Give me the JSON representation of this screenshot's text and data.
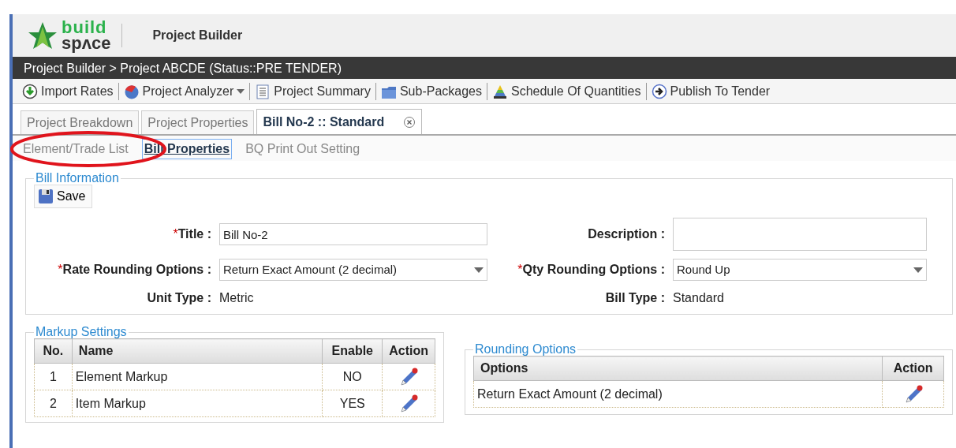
{
  "app": {
    "logo_top": "build",
    "logo_bottom": "spʌce",
    "title": "Project Builder"
  },
  "breadcrumb": "Project Builder > Project ABCDE (Status::PRE TENDER)",
  "toolbar": [
    {
      "label": "Import Rates",
      "kind": "import",
      "dropdown": false
    },
    {
      "label": "Project Analyzer",
      "kind": "chart",
      "dropdown": true
    },
    {
      "label": "Project Summary",
      "kind": "document",
      "dropdown": false
    },
    {
      "label": "Sub-Packages",
      "kind": "folder",
      "dropdown": false
    },
    {
      "label": "Schedule Of Quantities",
      "kind": "pyramid",
      "dropdown": false
    },
    {
      "label": "Publish To Tender",
      "kind": "publish",
      "dropdown": false
    }
  ],
  "tabs": [
    {
      "label": "Project Breakdown",
      "selected": false,
      "closable": false
    },
    {
      "label": "Project Properties",
      "selected": false,
      "closable": false
    },
    {
      "label": "Bill No-2 :: Standard",
      "selected": true,
      "closable": true
    }
  ],
  "subtabs": [
    {
      "label": "Element/Trade List",
      "selected": false,
      "circled": true
    },
    {
      "label": "Bill Properties",
      "selected": true,
      "circled": false
    },
    {
      "label": "BQ Print Out Setting",
      "selected": false,
      "circled": false
    }
  ],
  "bill_information": {
    "legend": "Bill Information",
    "save_label": "Save",
    "required_marker": "*",
    "fields": [
      {
        "label": "Title :",
        "required": true,
        "kind": "text",
        "value": "Bill No-2"
      },
      {
        "label": "Description :",
        "required": false,
        "kind": "textarea"
      },
      {
        "label": "Rate Rounding Options :",
        "required": true,
        "kind": "select",
        "value": "Return Exact Amount (2 decimal)"
      },
      {
        "label": "Qty Rounding Options :",
        "required": true,
        "kind": "select",
        "value": "Round Up"
      },
      {
        "label": "Unit Type :",
        "required": false,
        "kind": "static",
        "value": "Metric"
      },
      {
        "label": "Bill Type :",
        "required": false,
        "kind": "static",
        "value": "Standard"
      }
    ]
  },
  "markup_settings": {
    "legend": "Markup Settings",
    "columns": [
      "No.",
      "Name",
      "Enable",
      "Action"
    ],
    "rows": [
      {
        "no": "1",
        "name": "Element Markup",
        "enable": "NO"
      },
      {
        "no": "2",
        "name": "Item Markup",
        "enable": "YES"
      }
    ]
  },
  "rounding_options": {
    "legend": "Rounding Options",
    "columns": [
      "Options",
      "Action"
    ],
    "rows": [
      {
        "option": "Return Exact Amount (2 decimal)"
      }
    ]
  }
}
